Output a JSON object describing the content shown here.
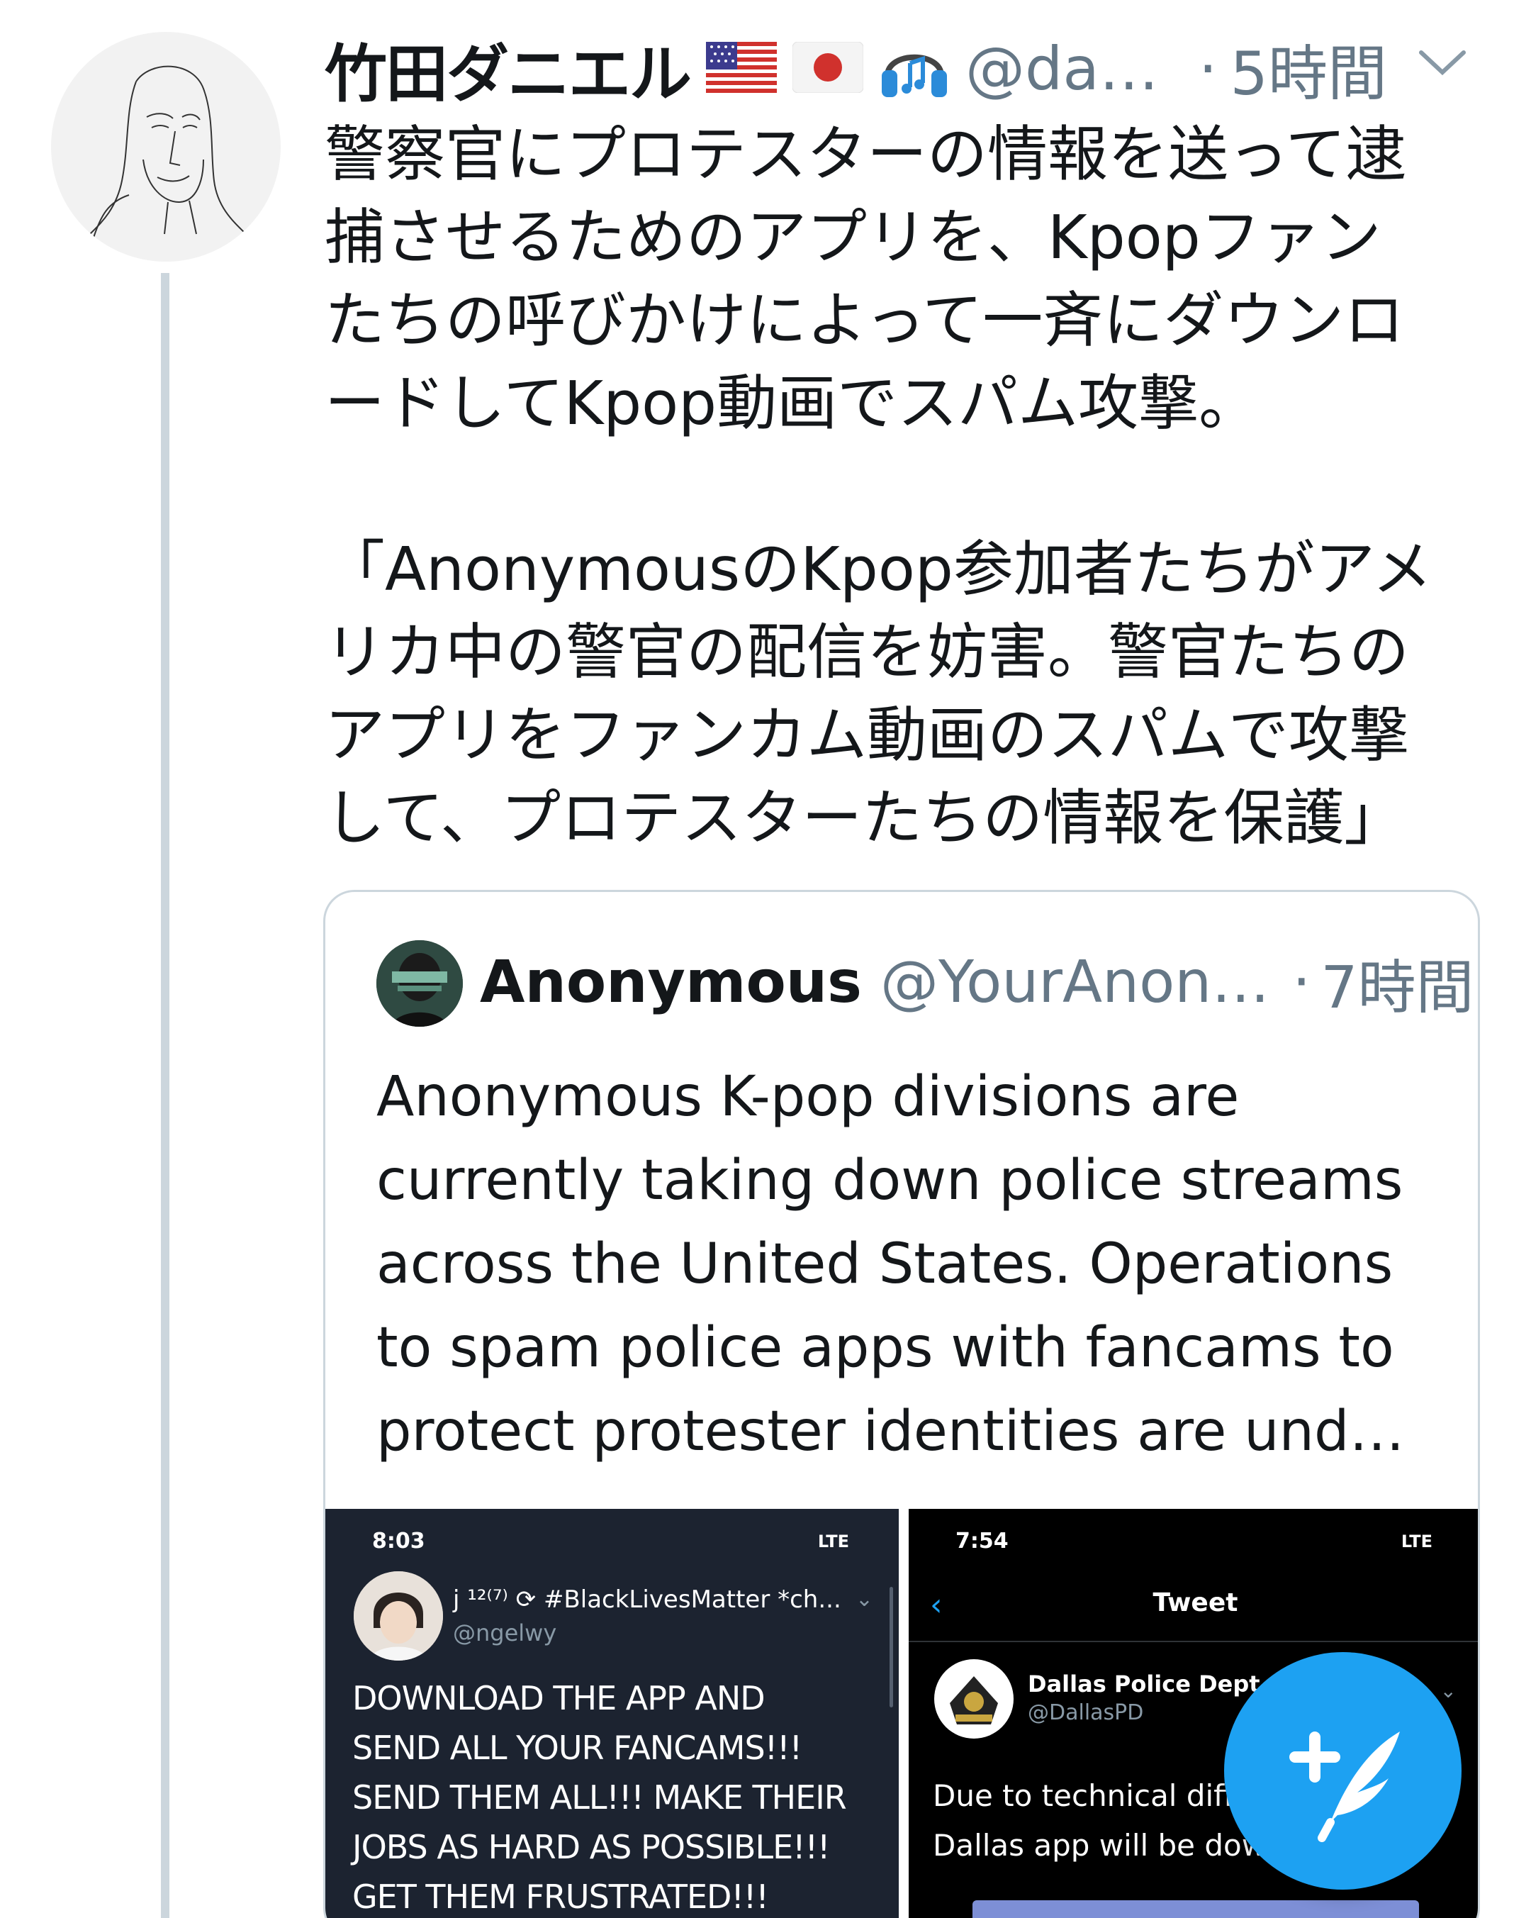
{
  "tweet": {
    "display_name": "竹田ダニエル",
    "emojis": [
      "us-flag-icon",
      "japan-flag-icon",
      "headphones-icon"
    ],
    "handle": "@da…",
    "separator": "·",
    "time": "5時間",
    "text_lines": [
      "警察官にプロテスターの情報を送って逮",
      "捕させるためのアプリを、Kpopファン",
      "たちの呼びかけによって一斉にダウンロ",
      "ードしてKpop動画でスパム攻撃。",
      "",
      "「AnonymousのKpop参加者たちがアメ",
      "リカ中の警官の配信を妨害。警官たちの",
      "アプリをファンカム動画のスパムで攻撃",
      "して、プロテスターたちの情報を保護」"
    ]
  },
  "quoted": {
    "display_name": "Anonymous",
    "handle": "@YourAnon…",
    "separator": "·",
    "time": "7時間",
    "text_lines": [
      "Anonymous K-pop divisions are",
      "currently taking down police streams",
      "across the United States. Operations",
      "to spam police apps with fancams to",
      "protect protester identities are und…"
    ],
    "media": {
      "left": {
        "clock": "8:03",
        "signal": "LTE",
        "name": "j ¹²⁽⁷⁾ ⟳ #BlackLivesMatter *ch...",
        "handle": "@ngelwy",
        "body_lines": [
          "DOWNLOAD THE APP AND",
          "SEND ALL YOUR FANCAMS!!!",
          "SEND THEM ALL!!! MAKE THEIR",
          "JOBS AS HARD AS POSSIBLE!!!",
          "GET THEM FRUSTRATED!!!"
        ]
      },
      "right": {
        "clock": "7:54",
        "signal": "LTE",
        "nav_title": "Tweet",
        "name": "Dallas Police Dept",
        "handle": "@DallasPD",
        "body_lines": [
          "Due to technical diffic",
          "Dallas app will be dow"
        ]
      }
    }
  },
  "fab": {
    "icon": "compose-tweet-icon",
    "color": "#1da1f2"
  },
  "colors": {
    "text": "#14171a",
    "secondary": "#657786",
    "border": "#ccd6dd",
    "accent": "#1da1f2"
  }
}
